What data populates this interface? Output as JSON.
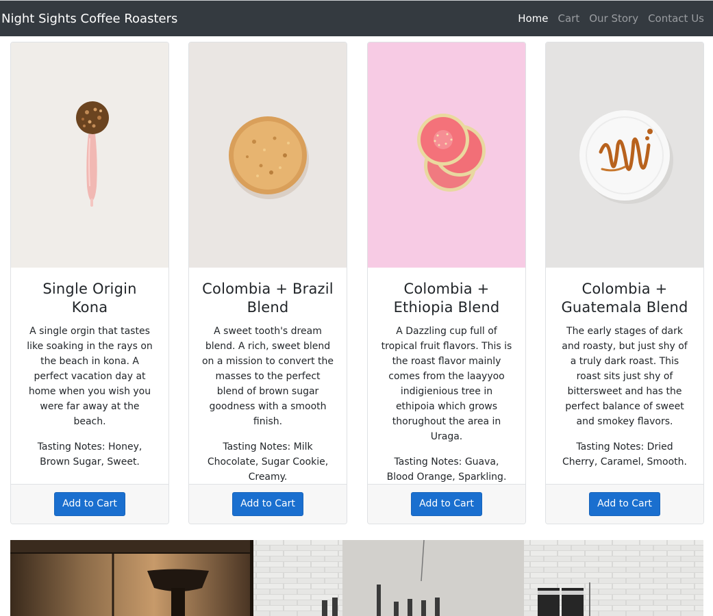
{
  "navbar": {
    "brand": "Night Sights Coffee Roasters",
    "links": [
      {
        "label": "Home",
        "active": true
      },
      {
        "label": "Cart",
        "active": false
      },
      {
        "label": "Our Story",
        "active": false
      },
      {
        "label": "Contact Us",
        "active": false
      }
    ]
  },
  "products": [
    {
      "title": "Single Origin Kona",
      "description": "A single orgin that tastes like soaking in the rays on the beach in kona. A perfect vacation day at home when you wish you were far away at the beach.",
      "tasting_notes": "Tasting Notes: Honey, Brown Sugar, Sweet.",
      "button": "Add to Cart",
      "image_icon": "sugar-scoop-icon",
      "image_bg": "#f0ede9"
    },
    {
      "title": "Colombia + Brazil Blend",
      "description": "A sweet tooth's dream blend. A rich, sweet blend on a mission to convert the masses to the perfect blend of brown sugar goodness with a smooth finish.",
      "tasting_notes": "Tasting Notes: Milk Chocolate, Sugar Cookie, Creamy.",
      "button": "Add to Cart",
      "image_icon": "cookie-icon",
      "image_bg": "#eae6e3"
    },
    {
      "title": "Colombia + Ethiopia Blend",
      "description": "A Dazzling cup full of tropical fruit flavors. This is the roast flavor mainly comes from the laayyoo indigienious tree in ethipoia which grows thorughout the area in Uraga.",
      "tasting_notes": "Tasting Notes: Guava, Blood Orange, Sparkling.",
      "button": "Add to Cart",
      "image_icon": "guava-slices-icon",
      "image_bg": "#f7cbe4"
    },
    {
      "title": "Colombia + Guatemala Blend",
      "description": "The early stages of dark and roasty, but just shy of a truly dark roast. This roast sits just shy of bittersweet and has the perfect balance of sweet and smokey flavors.",
      "tasting_notes": "Tasting Notes: Dried Cherry, Caramel, Smooth.",
      "button": "Add to Cart",
      "image_icon": "caramel-plate-icon",
      "image_bg": "#e4e3e2"
    }
  ],
  "hero_image_icon": "coffee-shop-counter-icon"
}
